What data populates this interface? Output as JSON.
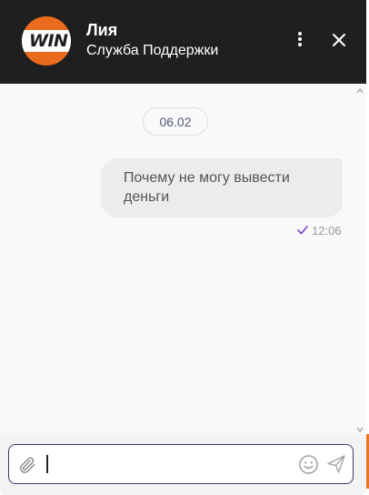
{
  "header": {
    "logo_text": "WIN",
    "agent_name": "Лия",
    "agent_role": "Служба Поддержки",
    "menu_icon": "vertical-dots-icon",
    "close_icon": "close-icon"
  },
  "conversation": {
    "date_label": "06.02",
    "messages": [
      {
        "direction": "outgoing",
        "text": "Почему не могу вывести деньги",
        "time": "12:06",
        "status_icon": "check-icon"
      }
    ]
  },
  "composer": {
    "value": "",
    "placeholder": "",
    "attach_icon": "paperclip-icon",
    "emoji_icon": "smiley-icon",
    "send_icon": "send-icon"
  },
  "colors": {
    "header_bg": "#1f1f1f",
    "brand_orange": "#ea6a1e",
    "input_border": "#3a3a6e",
    "read_check": "#7b3fc4",
    "bubble_bg": "#ececec"
  }
}
